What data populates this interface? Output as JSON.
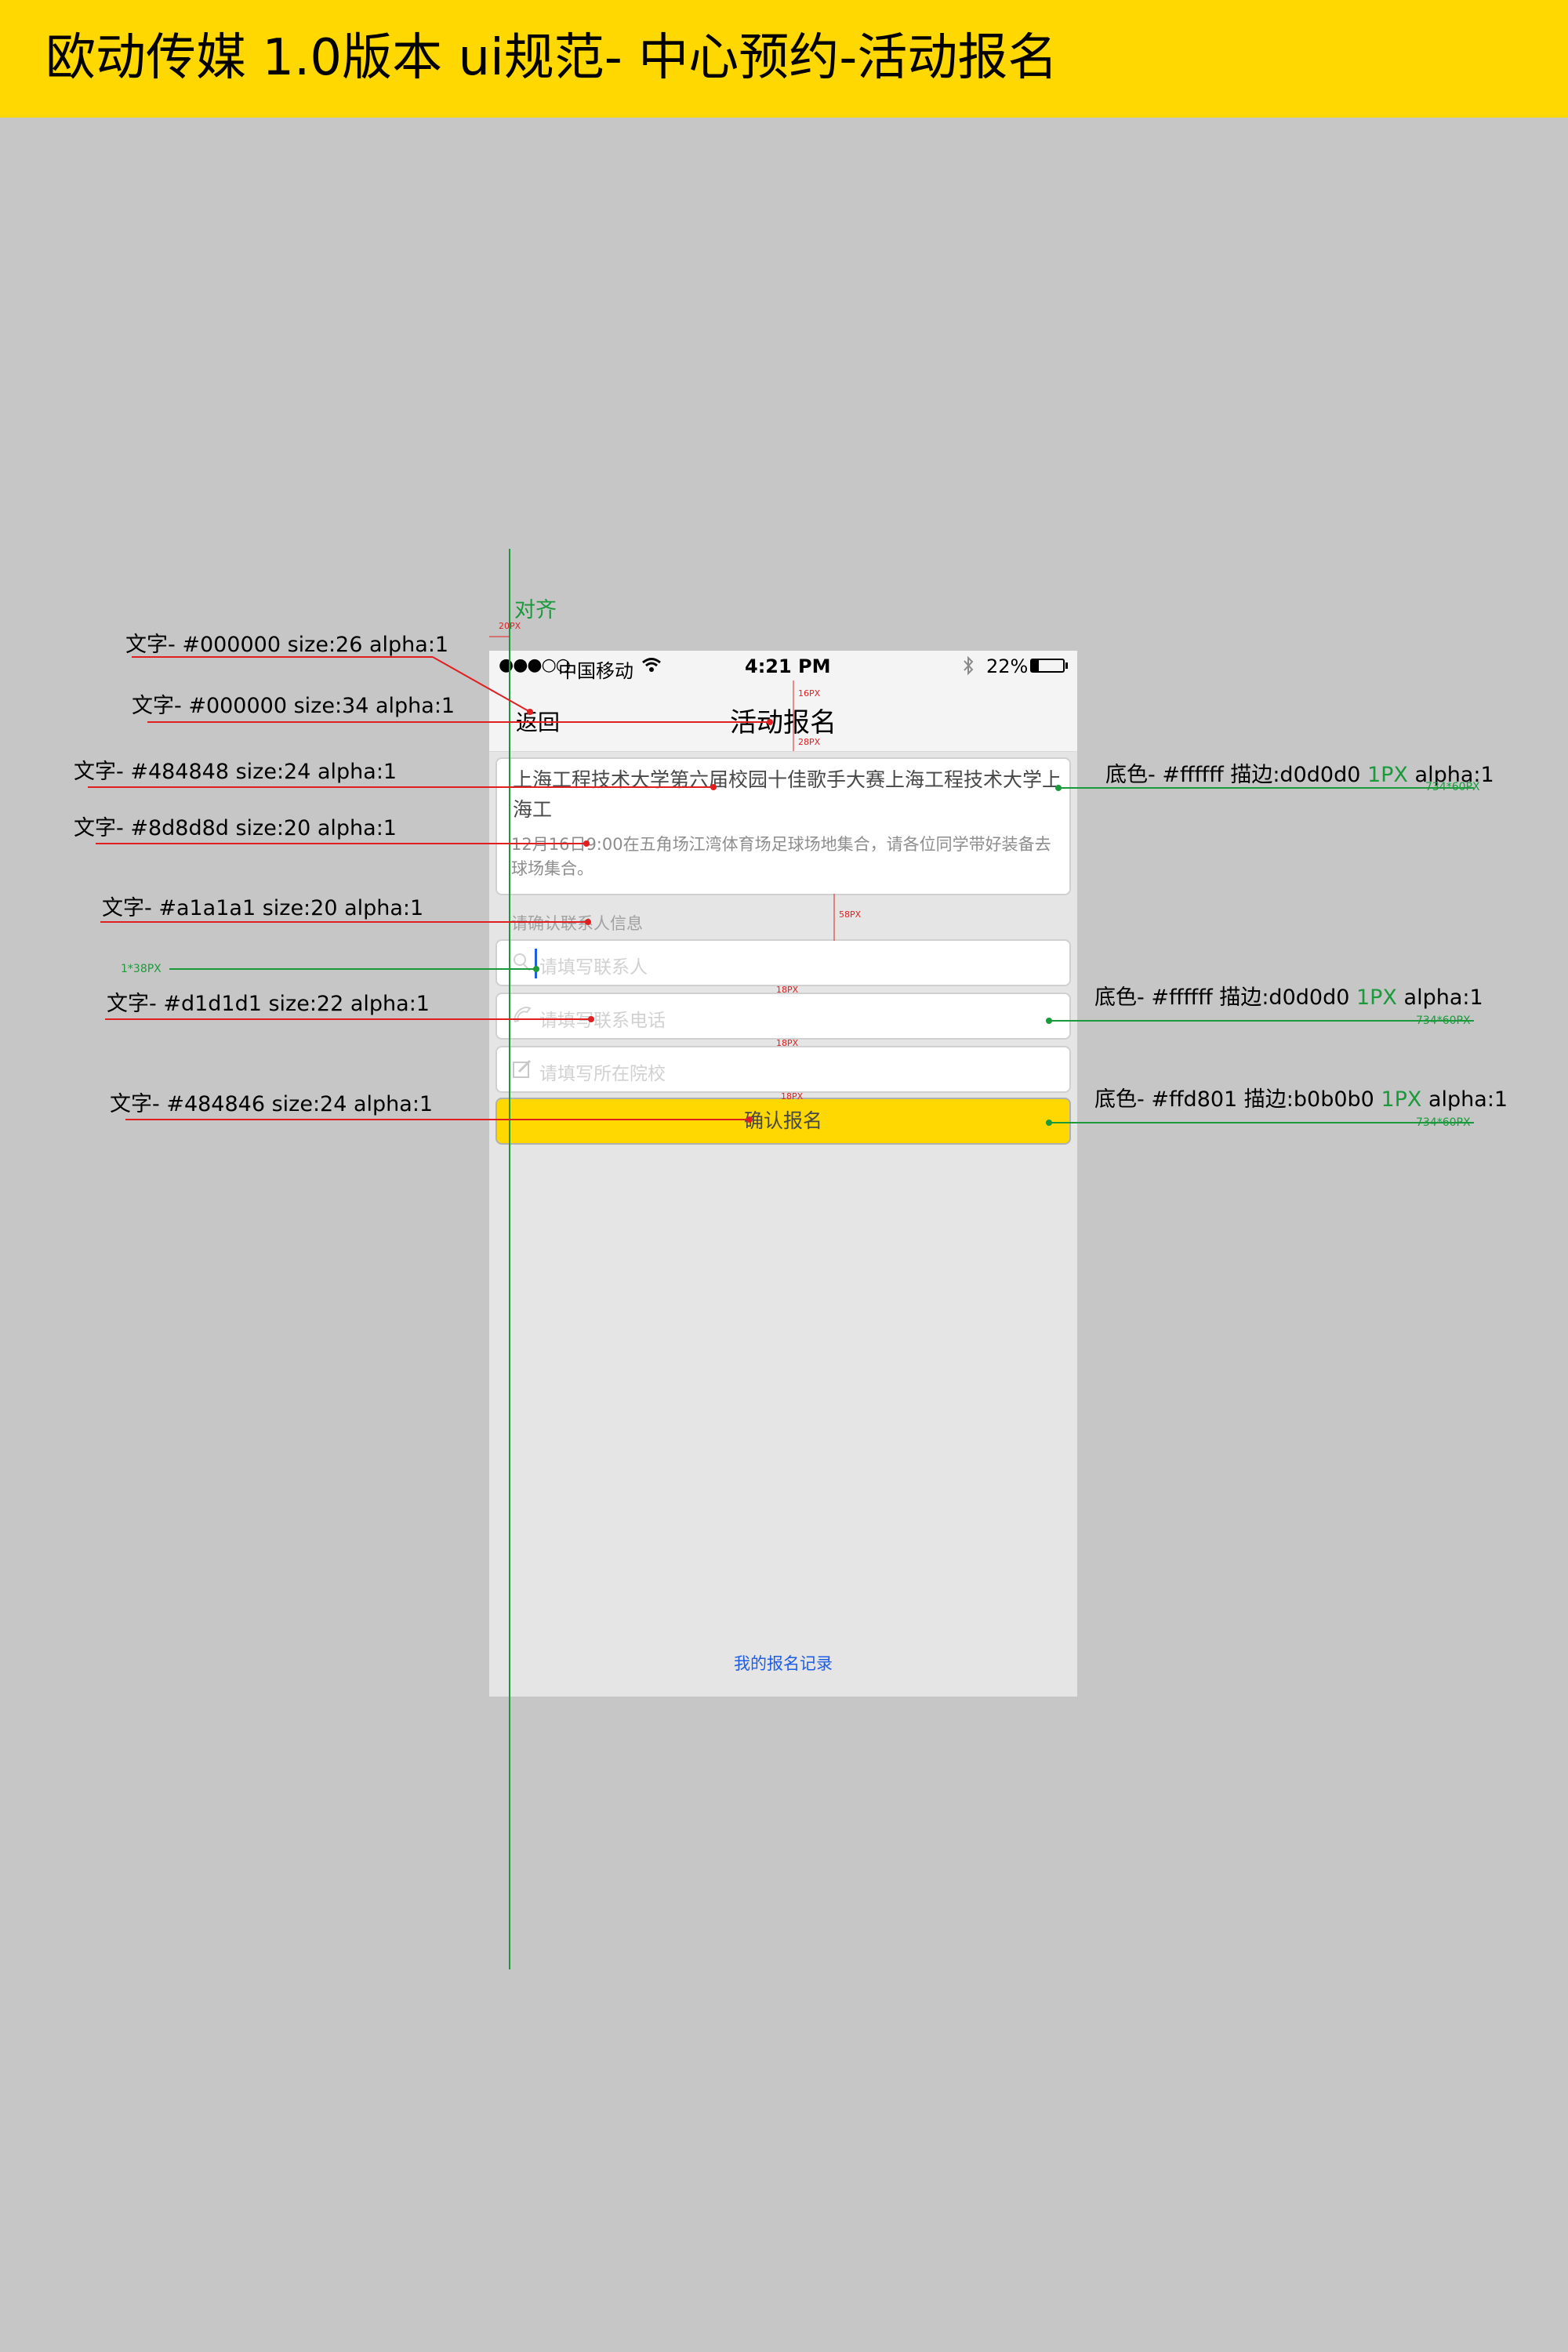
{
  "banner": {
    "title": "欧动传媒 1.0版本 ui规范- 中心预约-活动报名",
    "bg": "#ffd801"
  },
  "status_bar": {
    "signal": "●●●○○",
    "carrier": "中国移动",
    "time": "4:21 PM",
    "battery": "22%",
    "battery_level": 0.22
  },
  "nav": {
    "back": "返回",
    "title": "活动报名"
  },
  "activity": {
    "title": "上海工程技术大学第六届校园十佳歌手大赛上海工程技术大学上海工",
    "description": "12月16日9:00在五角场江湾体育场足球场地集合，请各位同学带好装备去球场集合。"
  },
  "form": {
    "section_label": "请确认联系人信息",
    "contact_placeholder": "请填写联系人",
    "phone_placeholder": "请填写联系电话",
    "school_placeholder": "请填写所在院校",
    "submit": "确认报名"
  },
  "records_link": "我的报名记录",
  "annotations": {
    "align": "对齐",
    "text_back": "文字- #000000 size:26 alpha:1",
    "text_title": "文字- #000000 size:34 alpha:1",
    "text_card_title": "文字- #484848 size:24 alpha:1",
    "text_card_desc": "文字- #8d8d8d size:20 alpha:1",
    "text_section": "文字- #a1a1a1 size:20 alpha:1",
    "cursor_size": "1*38PX",
    "text_placeholder": "文字- #d1d1d1 size:22 alpha:1",
    "text_button": "文字- #484846 size:24 alpha:1",
    "card_bg": {
      "prefix": "底色- #ffffff 描边:d0d0d0 ",
      "stroke": "1PX",
      "suffix": " alpha:1"
    },
    "field_bg": {
      "prefix": "底色- #ffffff 描边:d0d0d0 ",
      "stroke": "1PX",
      "suffix": " alpha:1"
    },
    "button_bg": {
      "prefix": "底色- #ffd801 描边:b0b0b0 ",
      "stroke": "1PX",
      "suffix": " alpha:1"
    },
    "size_734_1": "734*60PX",
    "size_734_2": "734*60PX",
    "size_734_3": "734*60PX",
    "dim_16": "16PX",
    "dim_28": "28PX",
    "dim_20": "20PX",
    "dim_58": "58PX",
    "dim_18a": "18PX",
    "dim_18b": "18PX",
    "dim_18c": "18PX"
  },
  "colors": {
    "red_line": "#e02020",
    "green_line": "#1b9a3c",
    "accent": "#ffd801",
    "link": "#1e5de6"
  }
}
